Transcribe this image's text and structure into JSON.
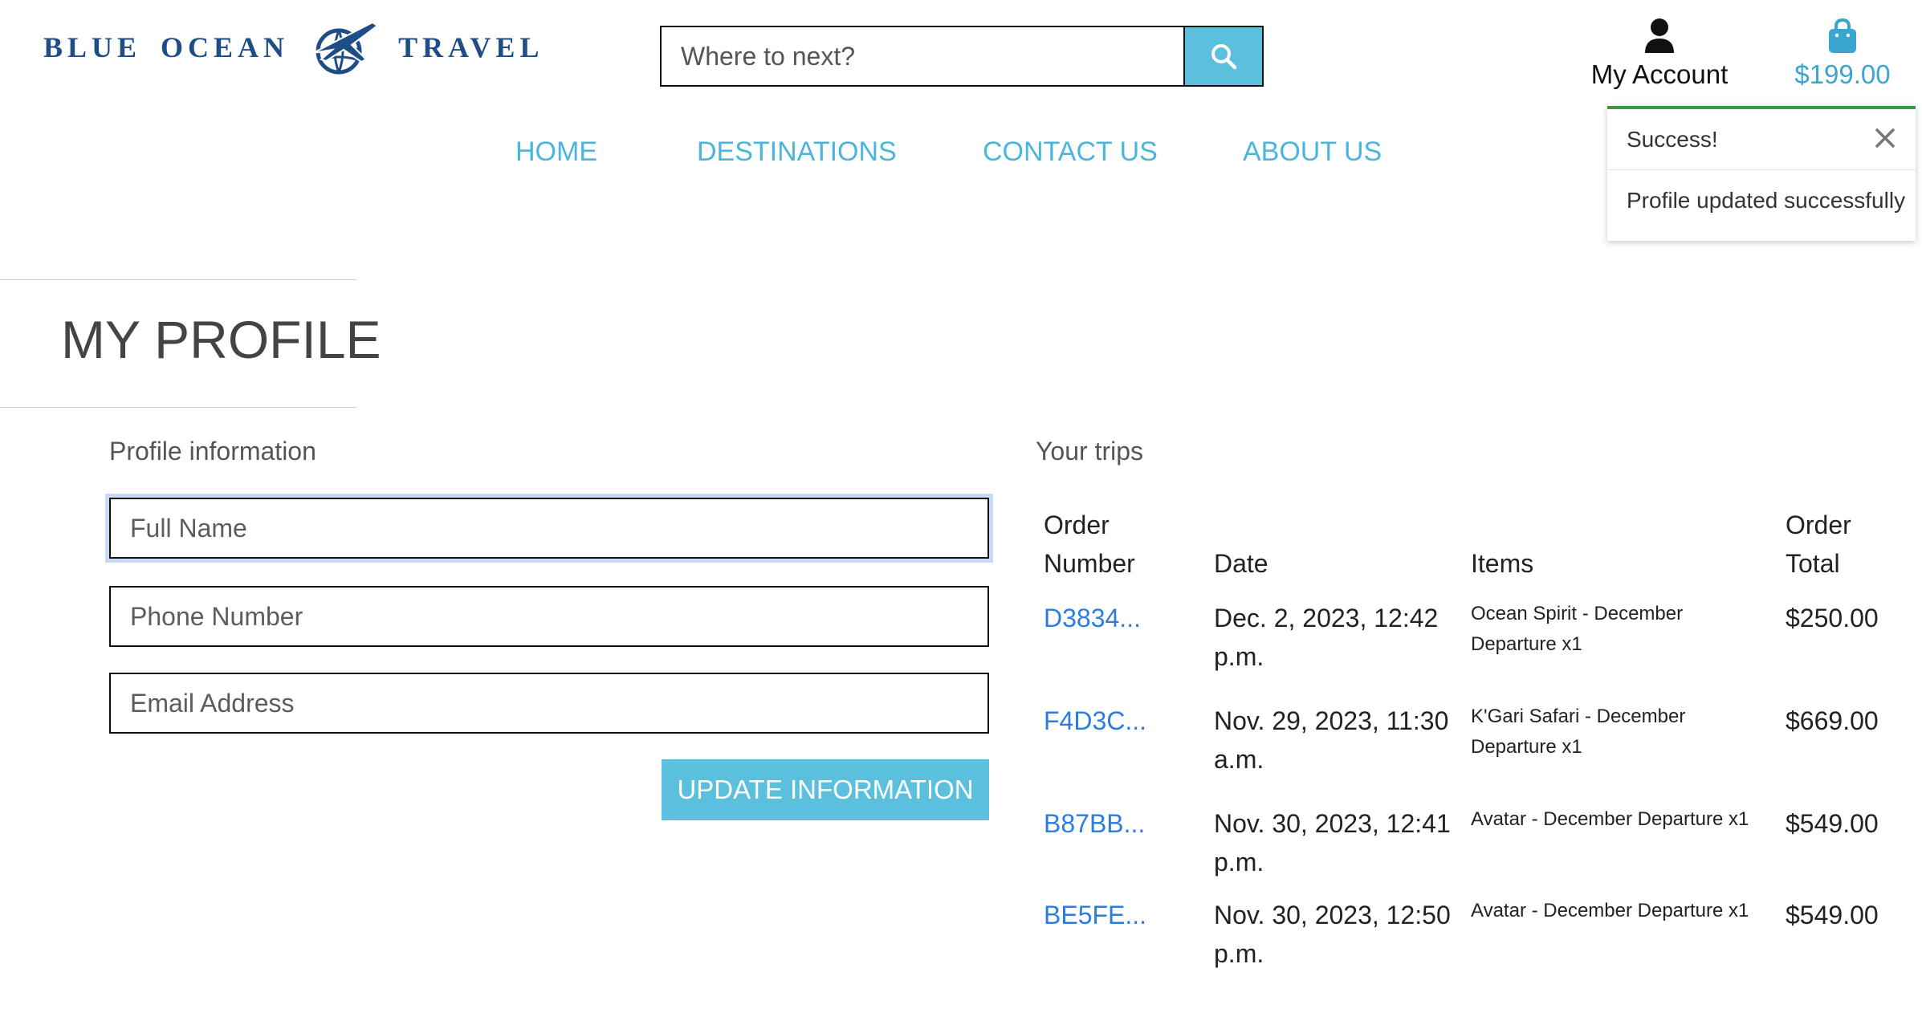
{
  "brand": {
    "word1": "BLUE",
    "word2": "OCEAN",
    "word3": "TRAVEL",
    "logo_icon": "globe-airplane-icon",
    "color": "#1f4e86"
  },
  "search": {
    "placeholder": "Where to next?",
    "value": "",
    "button_icon": "search-icon"
  },
  "account": {
    "label": "My Account",
    "icon": "user-icon"
  },
  "bag": {
    "amount": "$199.00",
    "icon": "shopping-bag-icon"
  },
  "nav": {
    "items": [
      {
        "label": "HOME"
      },
      {
        "label": "DESTINATIONS"
      },
      {
        "label": "CONTACT US"
      },
      {
        "label": "ABOUT US"
      }
    ]
  },
  "toast": {
    "title": "Success!",
    "message": "Profile updated successfully",
    "accent": "#3c9a3c"
  },
  "page": {
    "title": "MY PROFILE"
  },
  "profile": {
    "heading": "Profile information",
    "full_name": {
      "placeholder": "Full Name",
      "value": ""
    },
    "phone": {
      "placeholder": "Phone Number",
      "value": ""
    },
    "email": {
      "placeholder": "Email Address",
      "value": ""
    },
    "update_label": "UPDATE INFORMATION"
  },
  "trips": {
    "heading": "Your trips",
    "headers": {
      "order_number_line1": "Order",
      "order_number_line2": "Number",
      "date": "Date",
      "items": "Items",
      "order_total_line1": "Order",
      "order_total_line2": "Total"
    },
    "rows": [
      {
        "order": "D3834...",
        "date_line1": "Dec. 2, 2023, 12:42",
        "date_line2": "p.m.",
        "items_line1": "Ocean Spirit - December",
        "items_line2": "Departure x1",
        "total": "$250.00"
      },
      {
        "order": "F4D3C...",
        "date_line1": "Nov. 29, 2023, 11:30",
        "date_line2": "a.m.",
        "items_line1": "K'Gari Safari - December",
        "items_line2": "Departure x1",
        "total": "$669.00"
      },
      {
        "order": "B87BB...",
        "date_line1": "Nov. 30, 2023, 12:41",
        "date_line2": "p.m.",
        "items_line1": "Avatar - December Departure x1",
        "items_line2": "",
        "total": "$549.00"
      },
      {
        "order": "BE5FE...",
        "date_line1": "Nov. 30, 2023, 12:50",
        "date_line2": "p.m.",
        "items_line1": "Avatar - December Departure x1",
        "items_line2": "",
        "total": "$549.00"
      }
    ]
  },
  "colors": {
    "accent": "#5bc0de",
    "nav": "#4bb6dc",
    "link": "#2b7de0"
  }
}
